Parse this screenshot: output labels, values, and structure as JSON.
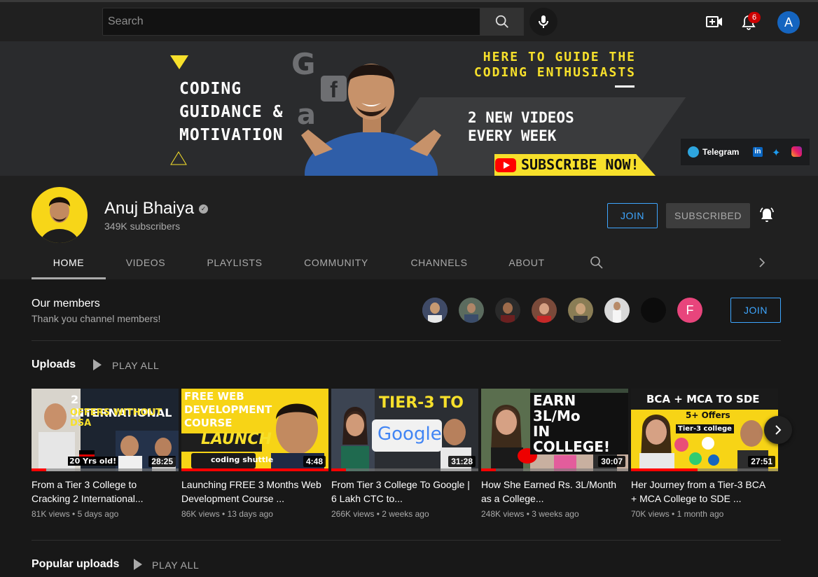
{
  "topbar": {
    "search_placeholder": "Search",
    "notification_count": "6",
    "account_initial": "A"
  },
  "banner": {
    "left_lines": [
      "CODING",
      "GUIDANCE &",
      "MOTIVATION"
    ],
    "right_top_lines": [
      "HERE TO GUIDE THE",
      "CODING ENTHUSIASTS"
    ],
    "new_videos_lines": [
      "2 NEW VIDEOS",
      "EVERY WEEK"
    ],
    "subscribe_text": "SUBSCRIBE NOW!",
    "telegram_label": "Telegram",
    "linkedin_label": "in",
    "accent_color": "#f7e02b"
  },
  "channel": {
    "name": "Anuj Bhaiya",
    "subscribers": "349K subscribers",
    "join_label": "JOIN",
    "subscribed_label": "SUBSCRIBED"
  },
  "tabs": [
    {
      "label": "HOME",
      "active": true
    },
    {
      "label": "VIDEOS",
      "active": false
    },
    {
      "label": "PLAYLISTS",
      "active": false
    },
    {
      "label": "COMMUNITY",
      "active": false
    },
    {
      "label": "CHANNELS",
      "active": false
    },
    {
      "label": "ABOUT",
      "active": false
    }
  ],
  "members": {
    "title": "Our members",
    "subtitle": "Thank you channel members!",
    "join_label": "JOIN",
    "last_member_initial": "F"
  },
  "uploads": {
    "title": "Uploads",
    "play_all": "PLAY ALL",
    "videos": [
      {
        "title": "From a Tier 3 College to Cracking 2 International...",
        "views": "81K views",
        "age": "5 days ago",
        "duration": "28:25",
        "thumb_lines": [
          "2 INTERNATIONAL",
          "OFFERS WITHOUT DSA"
        ],
        "thumb_caption": "20 Yrs old!",
        "watched": 0.1
      },
      {
        "title": "Launching FREE 3 Months Web Development Course ...",
        "views": "86K views",
        "age": "13 days ago",
        "duration": "4:48",
        "thumb_lines": [
          "FREE WEB",
          "DEVELOPMENT",
          "COURSE",
          "LAUNCH"
        ],
        "thumb_caption": "coding shuttle",
        "watched": 1.0
      },
      {
        "title": "From Tier 3 College To Google | 6 Lakh CTC to...",
        "views": "266K views",
        "age": "2 weeks ago",
        "duration": "31:28",
        "thumb_lines": [
          "TIER-3 TO",
          "Google"
        ],
        "thumb_caption": "",
        "watched": 0.1
      },
      {
        "title": "How She Earned Rs. 3L/Month as a College...",
        "views": "248K views",
        "age": "3 weeks ago",
        "duration": "30:07",
        "thumb_lines": [
          "EARN 3L/Mo",
          "IN COLLEGE!"
        ],
        "thumb_caption": "",
        "watched": 0.1
      },
      {
        "title": "Her Journey from a Tier-3 BCA + MCA College to SDE ...",
        "views": "70K views",
        "age": "1 month ago",
        "duration": "27:51",
        "thumb_lines": [
          "BCA + MCA TO SDE",
          "5+ Offers",
          "Tier-3 college"
        ],
        "thumb_caption": "",
        "watched": 0.45
      }
    ]
  },
  "popular": {
    "title": "Popular uploads",
    "play_all": "PLAY ALL"
  }
}
